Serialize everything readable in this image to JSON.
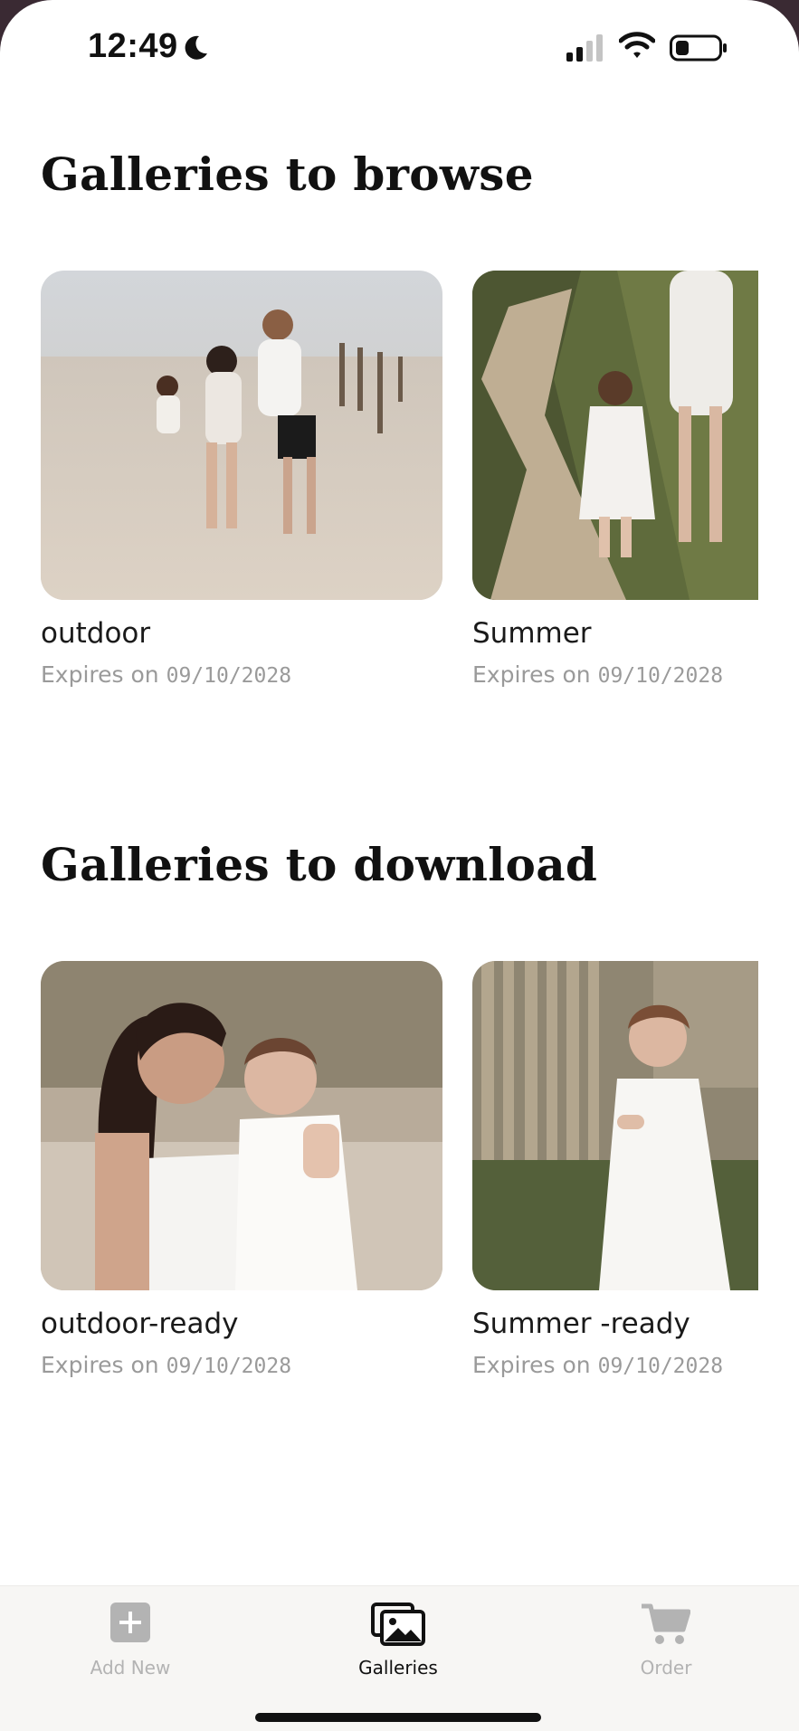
{
  "status": {
    "time": "12:49",
    "icons": [
      "moon-icon",
      "signal-icon",
      "wifi-icon",
      "battery-icon"
    ]
  },
  "sections": {
    "browse": {
      "title": "Galleries to browse",
      "cards": [
        {
          "name": "outdoor",
          "expires_label": "Expires on",
          "expires_date": "09/10/2028"
        },
        {
          "name": "Summer",
          "expires_label": "Expires on",
          "expires_date": "09/10/2028"
        }
      ]
    },
    "download": {
      "title": "Galleries to download",
      "cards": [
        {
          "name": "outdoor-ready",
          "expires_label": "Expires on",
          "expires_date": "09/10/2028"
        },
        {
          "name": "Summer -ready",
          "expires_label": "Expires on",
          "expires_date": "09/10/2028"
        }
      ]
    }
  },
  "tabs": [
    {
      "label": "Add New",
      "icon": "plus-square-icon",
      "active": false
    },
    {
      "label": "Galleries",
      "icon": "gallery-icon",
      "active": true
    },
    {
      "label": "Order",
      "icon": "cart-icon",
      "active": false
    }
  ],
  "colors": {
    "active_tab": "#111111",
    "inactive_tab": "#b3b3b3",
    "tab_bar_bg": "#f7f6f4",
    "expiry_text": "#9a9a9a"
  }
}
